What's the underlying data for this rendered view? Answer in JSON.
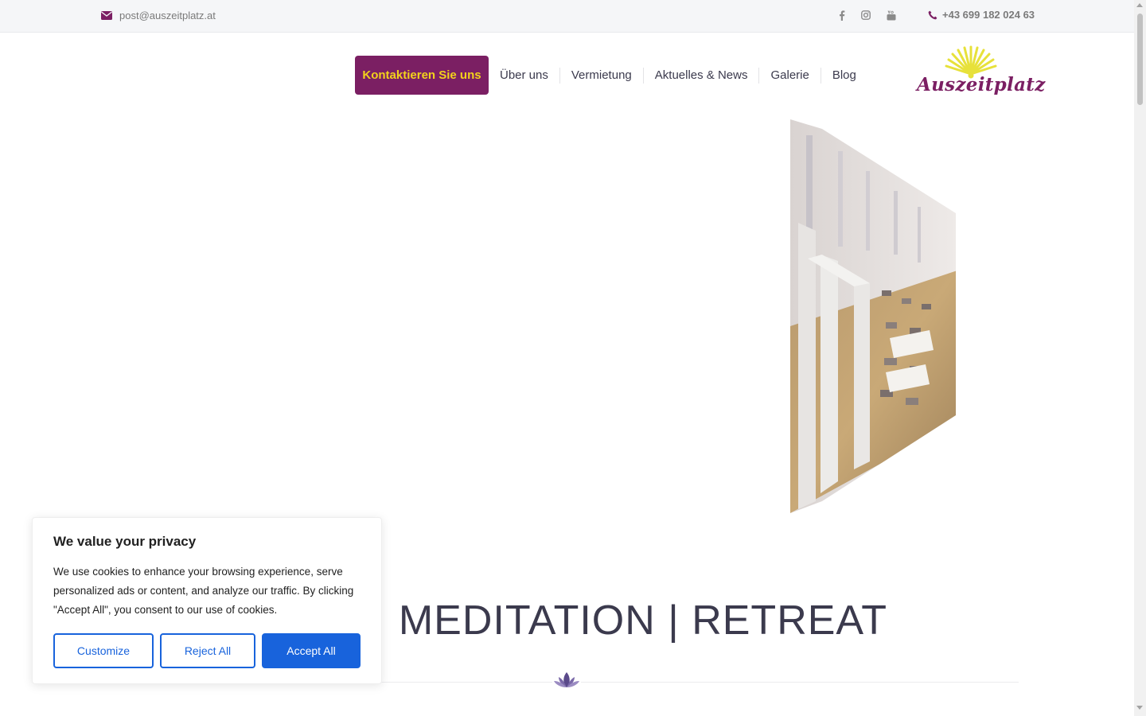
{
  "topbar": {
    "email": "post@auszeitplatz.at",
    "phone": "+43 699 182 024 63",
    "social": [
      "facebook-icon",
      "instagram-icon",
      "youtube-icon"
    ]
  },
  "nav": {
    "cta_label": "Kontaktieren Sie uns",
    "items": [
      "Über uns",
      "Vermietung",
      "Aktuelles & News",
      "Galerie",
      "Blog"
    ]
  },
  "logo": {
    "text": "Auszeitplatz"
  },
  "hero": {
    "heading": "I | MEDITATION | RETREAT"
  },
  "cookie": {
    "title": "We value your privacy",
    "text": "We use cookies to enhance your browsing experience, serve personalized ads or content, and analyze our traffic. By clicking \"Accept All\", you consent to our use of cookies.",
    "customize": "Customize",
    "reject": "Reject All",
    "accept": "Accept All"
  },
  "colors": {
    "brand": "#7b1f63",
    "cta_text": "#f2d21c",
    "nav_text": "#3b3a4d",
    "cookie_accent": "#1863dc",
    "sun": "#e7e13a"
  }
}
